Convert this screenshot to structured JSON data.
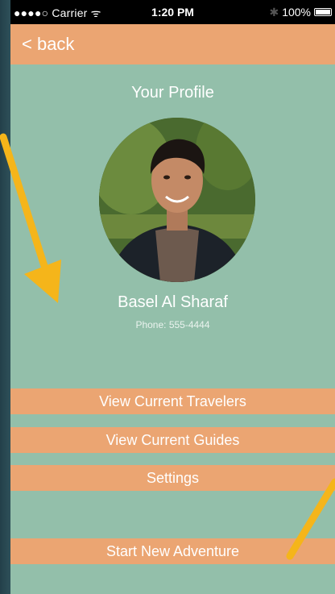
{
  "status_bar": {
    "carrier": "●●●●○ Carrier ᯤ",
    "time": "1:20 PM",
    "battery": "100%"
  },
  "nav": {
    "back_label": "< back"
  },
  "profile": {
    "title": "Your Profile",
    "name": "Basel Al Sharaf",
    "phone": "Phone: 555-4444"
  },
  "menu": {
    "travelers": "View Current Travelers",
    "guides": "View Current Guides",
    "settings": "Settings",
    "adventure": "Start New Adventure"
  },
  "colors": {
    "background": "#93bfaa",
    "accent": "#eba572",
    "arrow": "#f4b400"
  }
}
